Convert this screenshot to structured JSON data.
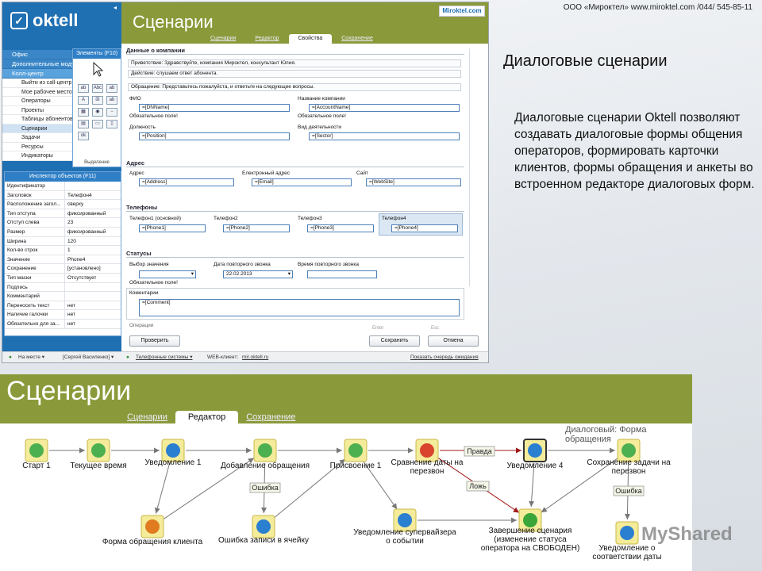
{
  "slide": {
    "topline": "ООО «Мироктел» www.miroktel.com /044/ 545-85-11",
    "title": "Диалоговые сценарии",
    "text": "Диалоговые сценарии Oktell позволяют создавать диалоговые формы общения операторов, формировать карточки клиентов, формы обращения и анкеты во встроенном редакторе диалоговых форм."
  },
  "s1": {
    "logo": "oktell",
    "collapse": "◂",
    "title": "Сценарии",
    "brand": "Miroktel.com",
    "tabs": [
      "Сценарии",
      "Редактор",
      "Свойства",
      "Сохранение"
    ],
    "nav_sections": [
      "Офис",
      "Дополнительные модули",
      "Колл-центр"
    ],
    "nav_items": [
      "Выйти из call-центр",
      "Мое рабочее место",
      "Операторы",
      "Проекты",
      "Таблицы абонентов",
      "Сценарии",
      "Задачи",
      "Ресурсы",
      "Индикаторы"
    ],
    "palette": {
      "header": "Элементы (F10)",
      "footer": "Выделение",
      "icons": [
        "ab",
        "Abc",
        "ab",
        "A",
        "",
        "ab",
        "",
        "",
        "",
        "",
        "",
        "",
        "",
        "",
        ""
      ]
    },
    "inspector": {
      "header": "Инспектор объектов (F11)",
      "rows": [
        [
          "Идентификатор",
          ""
        ],
        [
          "Заголовок",
          "Телефон4"
        ],
        [
          "Расположение загол...",
          "сверху"
        ],
        [
          "Тип отступа",
          "фиксированный"
        ],
        [
          "Отступ слева",
          "23"
        ],
        [
          "Размер",
          "фиксированный"
        ],
        [
          "Ширина",
          "120"
        ],
        [
          "Кол-во строк",
          "1"
        ],
        [
          "Значение",
          "Phone4"
        ],
        [
          "Сохранение",
          "[установлено]"
        ],
        [
          "Тип маски",
          "Отсутствует"
        ],
        [
          "Подпись",
          ""
        ],
        [
          "Комментарий",
          ""
        ],
        [
          "Переносить текст",
          "нет"
        ],
        [
          "Наличие галочки",
          "нет"
        ],
        [
          "Обязательно для за...",
          "нет"
        ]
      ]
    },
    "form": {
      "sec_company": "Данные о компании",
      "greet": "Приветствие: Здравствуйте, компания Мироктел, консультант Юлия.",
      "action": "Действие: слушаем ответ абонента.",
      "appeal": "Обращение: Представьтесь пожалуйста, и ответьте на следующие вопросы.",
      "lbl_fio": "ФИО",
      "inp_fio": "=[DNName]",
      "lbl_company": "Название компании",
      "inp_company": "=[AccountName]",
      "req": "Обязательное поле!",
      "lbl_pos": "Должность",
      "inp_pos": "=[Position]",
      "lbl_act": "Вид деятельности",
      "inp_act": "=[Sector]",
      "sec_addr": "Адрес",
      "lbl_addr": "Адрес",
      "inp_addr": "=[Address]",
      "lbl_email": "Електронный адрес",
      "inp_email": "=[Email]",
      "lbl_site": "Сайт",
      "inp_site": "=[WebSite]",
      "sec_phones": "Телефоны",
      "lbl_ph1": "Телефон1 (основной)",
      "inp_ph1": "=[Phone1]",
      "lbl_ph2": "Телефон2",
      "inp_ph2": "=[Phone2]",
      "lbl_ph3": "Телефон3",
      "inp_ph3": "=[Phone3]",
      "lbl_ph4": "Телефон4",
      "inp_ph4": "=[Phone4]",
      "sec_status": "Статусы",
      "lbl_sel": "Выбор значения",
      "lbl_date": "Дата повторного звонка",
      "inp_date": "22.02.2013",
      "lbl_time": "Время повторного звонка",
      "lbl_comm": "Коментарии",
      "inp_comm": "=[Comment]",
      "more": "Операции"
    },
    "buttons": {
      "check": "Проверить",
      "save": "Сохранить",
      "cancel": "Отмена",
      "hint_enter": "Enter",
      "hint_esc": "Esc"
    },
    "status": {
      "state": "На месте ▾",
      "user": "[Сергей Василенко] ▾",
      "systems": "Телефонные системы ▾",
      "web_label": "WEB-клиент:",
      "web_link": "mir.oktell.ru",
      "queue": "Показать очередь ожидания"
    }
  },
  "s2": {
    "title": "Сценарии",
    "tabs": [
      "Сценарии",
      "Редактор",
      "Сохранение"
    ],
    "crumb": "Диалоговый: Форма обращения",
    "nodes": [
      {
        "id": "start",
        "label": "Старт 1",
        "icon": "start-icon"
      },
      {
        "id": "time",
        "label": "Текущее время",
        "icon": "assign-icon"
      },
      {
        "id": "note1",
        "label": "Уведомление 1",
        "icon": "info-icon"
      },
      {
        "id": "addreq",
        "label": "Добавление обращения",
        "icon": "sql-icon"
      },
      {
        "id": "assign1",
        "label": "Присвоение 1",
        "icon": "assign-icon"
      },
      {
        "id": "compare",
        "label": "Сравнение даты на перезвон",
        "icon": "compare-icon"
      },
      {
        "id": "note4",
        "label": "Уведомление 4",
        "icon": "info-icon"
      },
      {
        "id": "savetask",
        "label": "Сохранение задачи на перезвон",
        "icon": "sql-icon"
      },
      {
        "id": "form",
        "label": "Форма обращения клиента",
        "icon": "form-icon"
      },
      {
        "id": "errcell",
        "label": "Ошибка записи в ячейку",
        "icon": "info-icon"
      },
      {
        "id": "supervisor",
        "label": "Уведомление супервайзера о событии",
        "icon": "info-icon"
      },
      {
        "id": "finish",
        "label": "Завершение сценария (изменение статуса оператора на СВОБОДЕН)",
        "icon": "check-icon"
      },
      {
        "id": "datenote",
        "label": "Уведомление о соответствии даты",
        "icon": "info-icon"
      }
    ],
    "edge_labels": {
      "true": "Правда",
      "false": "Ложь",
      "error": "Ошибка"
    }
  },
  "watermark": "MyShared"
}
